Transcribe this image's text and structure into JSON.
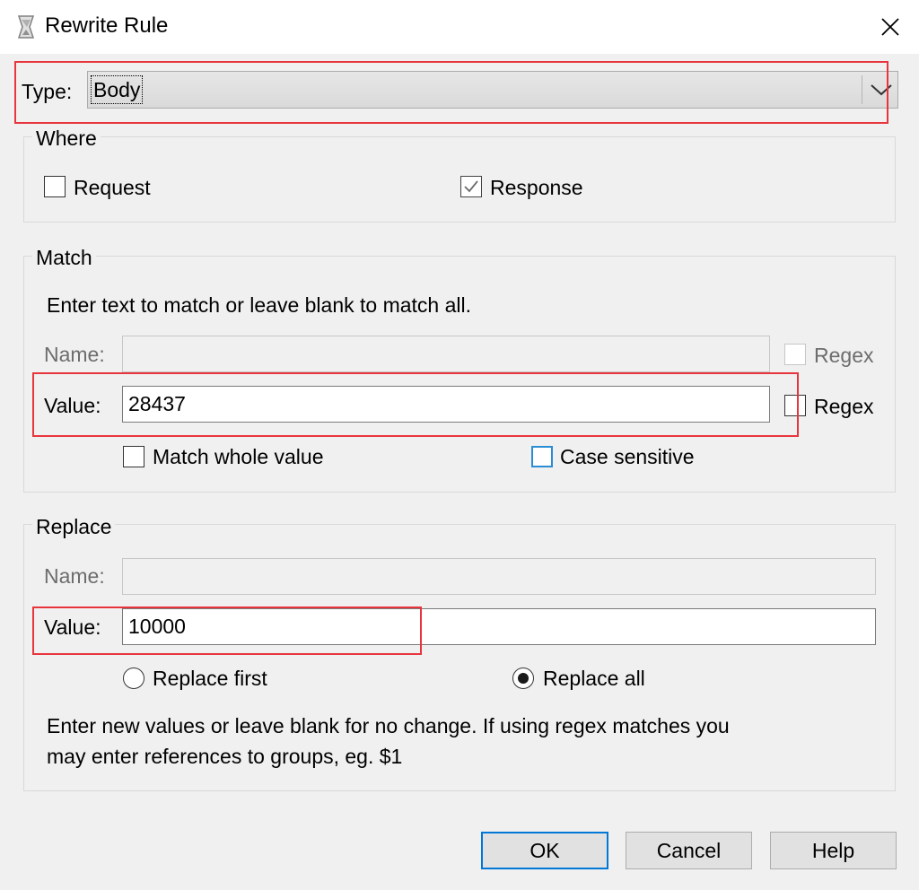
{
  "window": {
    "title": "Rewrite Rule"
  },
  "type": {
    "label": "Type:",
    "selected": "Body"
  },
  "where": {
    "legend": "Where",
    "request_label": "Request",
    "request_checked": false,
    "response_label": "Response",
    "response_checked": true
  },
  "match": {
    "legend": "Match",
    "hint": "Enter text to match or leave blank to match all.",
    "name_label": "Name:",
    "name_value": "",
    "name_regex_label": "Regex",
    "value_label": "Value:",
    "value_value": "28437",
    "value_regex_label": "Regex",
    "whole_value_label": "Match whole value",
    "case_sensitive_label": "Case sensitive"
  },
  "replace": {
    "legend": "Replace",
    "name_label": "Name:",
    "name_value": "",
    "value_label": "Value:",
    "value_value": "10000",
    "replace_first_label": "Replace first",
    "replace_all_label": "Replace all",
    "selected_mode": "Replace all",
    "hint_line1": "Enter new values or leave blank for no change. If using regex matches you",
    "hint_line2": "may enter references to groups, eg. $1"
  },
  "buttons": {
    "ok": "OK",
    "cancel": "Cancel",
    "help": "Help"
  },
  "colors": {
    "highlight": "#e8353d",
    "focus": "#0078d7",
    "case_sensitive_border": "#2a8dd4"
  }
}
